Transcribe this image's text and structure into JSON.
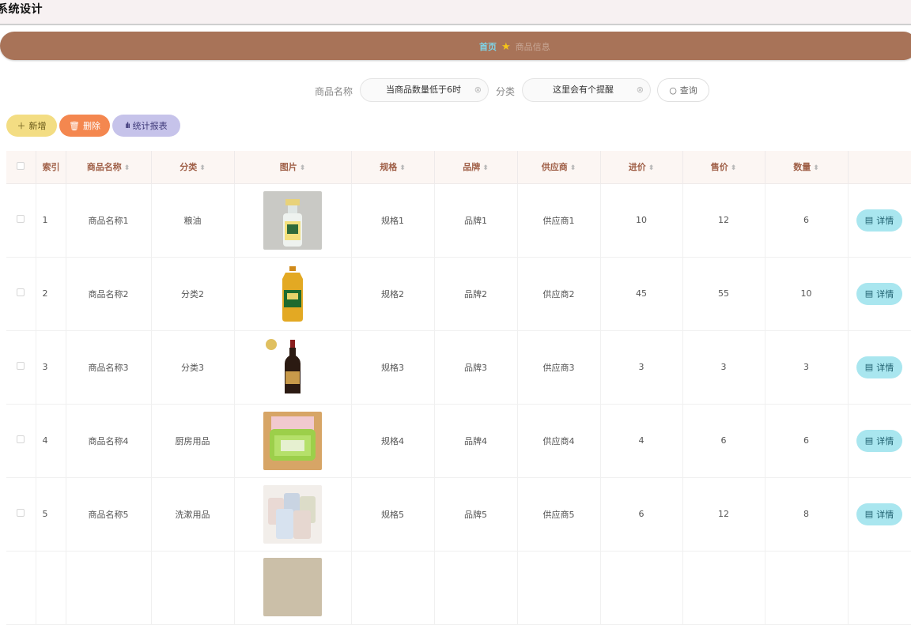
{
  "header": {
    "title": "系统设计"
  },
  "breadcrumb": {
    "home": "首页",
    "current": "商品信息"
  },
  "search": {
    "name_label": "商品名称",
    "name_value": "当商品数量低于6时",
    "category_label": "分类",
    "category_value": "这里会有个提醒",
    "query_label": "查询"
  },
  "actions": {
    "add": "新增",
    "delete": "删除",
    "report": "统计报表"
  },
  "table": {
    "headers": [
      "索引",
      "商品名称",
      "分类",
      "图片",
      "规格",
      "品牌",
      "供应商",
      "进价",
      "售价",
      "数量"
    ],
    "detail_label": "详情",
    "rows": [
      {
        "index": "1",
        "name": "商品名称1",
        "category": "粮油",
        "image": "liquor-bottle",
        "spec": "规格1",
        "brand": "品牌1",
        "supplier": "供应商1",
        "cost": "10",
        "price": "12",
        "qty": "6"
      },
      {
        "index": "2",
        "name": "商品名称2",
        "category": "分类2",
        "image": "cooking-oil",
        "spec": "规格2",
        "brand": "品牌2",
        "supplier": "供应商2",
        "cost": "45",
        "price": "55",
        "qty": "10"
      },
      {
        "index": "3",
        "name": "商品名称3",
        "category": "分类3",
        "image": "soy-sauce",
        "spec": "规格3",
        "brand": "品牌3",
        "supplier": "供应商3",
        "cost": "3",
        "price": "3",
        "qty": "3"
      },
      {
        "index": "4",
        "name": "商品名称4",
        "category": "厨房用品",
        "image": "utensil-holder",
        "spec": "规格4",
        "brand": "品牌4",
        "supplier": "供应商4",
        "cost": "4",
        "price": "6",
        "qty": "6"
      },
      {
        "index": "5",
        "name": "商品名称5",
        "category": "洗漱用品",
        "image": "cups",
        "spec": "规格5",
        "brand": "品牌5",
        "supplier": "供应商5",
        "cost": "6",
        "price": "12",
        "qty": "8"
      }
    ]
  },
  "colors": {
    "breadcrumb_bg": "#a87358",
    "add": "#f3dd83",
    "delete": "#f4874f",
    "report": "#c6c3ea",
    "detail": "#a9e6ef"
  }
}
